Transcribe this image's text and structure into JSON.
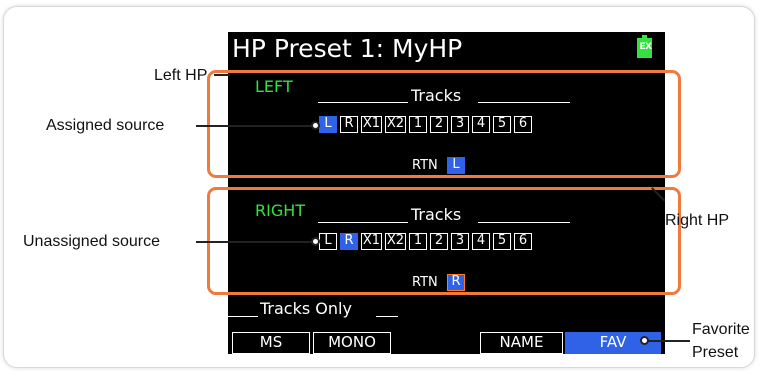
{
  "screen": {
    "title": "HP Preset 1: MyHP",
    "battery_label": "EX",
    "left": {
      "label": "LEFT",
      "tracks_header": "Tracks",
      "sources": [
        "L",
        "R",
        "X1",
        "X2",
        "1",
        "2",
        "3",
        "4",
        "5",
        "6"
      ],
      "selected": [
        "L"
      ],
      "rtn_label": "RTN",
      "rtn_value": "L"
    },
    "right": {
      "label": "RIGHT",
      "tracks_header": "Tracks",
      "sources": [
        "L",
        "R",
        "X1",
        "X2",
        "1",
        "2",
        "3",
        "4",
        "5",
        "6"
      ],
      "selected": [
        "R"
      ],
      "rtn_label": "RTN",
      "rtn_value": "R"
    },
    "tracks_only": "Tracks Only",
    "softkeys": {
      "ms": "MS",
      "mono": "MONO",
      "name": "NAME",
      "fav": "FAV"
    }
  },
  "callouts": {
    "left_hp": "Left HP",
    "assigned_source": "Assigned source",
    "right_hp": "Right HP",
    "unassigned_source": "Unassigned source",
    "favorite_preset_line1": "Favorite",
    "favorite_preset_line2": "Preset"
  },
  "colors": {
    "screen_bg": "#000000",
    "accent_green": "#33e23e",
    "selected_blue": "#2f62e6",
    "highlight_orange": "#f07a3c"
  }
}
